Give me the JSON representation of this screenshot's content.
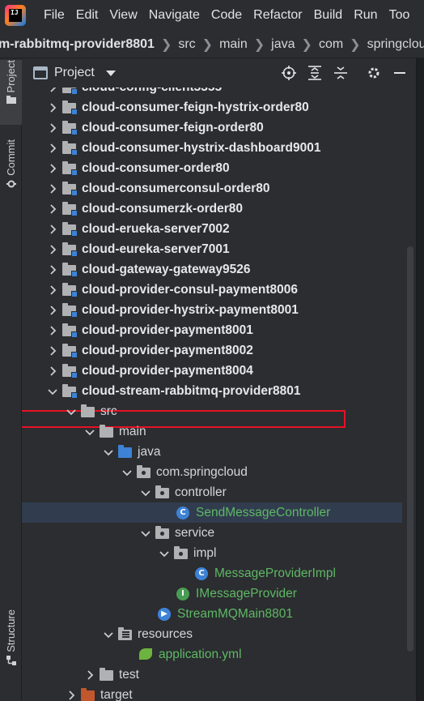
{
  "menu": [
    "File",
    "Edit",
    "View",
    "Navigate",
    "Code",
    "Refactor",
    "Build",
    "Run",
    "Too"
  ],
  "breadcrumb": [
    "m-rabbitmq-provider8801",
    "src",
    "main",
    "java",
    "com",
    "springcloud"
  ],
  "toolstrip": {
    "project_label": "Project",
    "commit_label": "Commit",
    "structure_label": "Structure"
  },
  "panel": {
    "title": "Project"
  },
  "tree": [
    {
      "label": "cloud-config-client3355",
      "type": "module",
      "depth": 0,
      "chevron": "right"
    },
    {
      "label": "cloud-consumer-feign-hystrix-order80",
      "type": "module",
      "depth": 0,
      "chevron": "right"
    },
    {
      "label": "cloud-consumer-feign-order80",
      "type": "module",
      "depth": 0,
      "chevron": "right"
    },
    {
      "label": "cloud-consumer-hystrix-dashboard9001",
      "type": "module",
      "depth": 0,
      "chevron": "right"
    },
    {
      "label": "cloud-consumer-order80",
      "type": "module",
      "depth": 0,
      "chevron": "right"
    },
    {
      "label": "cloud-consumerconsul-order80",
      "type": "module",
      "depth": 0,
      "chevron": "right"
    },
    {
      "label": "cloud-consumerzk-order80",
      "type": "module",
      "depth": 0,
      "chevron": "right"
    },
    {
      "label": "cloud-erueka-server7002",
      "type": "module",
      "depth": 0,
      "chevron": "right"
    },
    {
      "label": "cloud-eureka-server7001",
      "type": "module",
      "depth": 0,
      "chevron": "right"
    },
    {
      "label": "cloud-gateway-gateway9526",
      "type": "module",
      "depth": 0,
      "chevron": "right"
    },
    {
      "label": "cloud-provider-consul-payment8006",
      "type": "module",
      "depth": 0,
      "chevron": "right"
    },
    {
      "label": "cloud-provider-hystrix-payment8001",
      "type": "module",
      "depth": 0,
      "chevron": "right"
    },
    {
      "label": "cloud-provider-payment8001",
      "type": "module",
      "depth": 0,
      "chevron": "right"
    },
    {
      "label": "cloud-provider-payment8002",
      "type": "module",
      "depth": 0,
      "chevron": "right"
    },
    {
      "label": "cloud-provider-payment8004",
      "type": "module",
      "depth": 0,
      "chevron": "right"
    },
    {
      "label": "cloud-stream-rabbitmq-provider8801",
      "type": "module",
      "depth": 0,
      "chevron": "down"
    },
    {
      "label": "src",
      "type": "folder",
      "depth": 1,
      "chevron": "down"
    },
    {
      "label": "main",
      "type": "folder",
      "depth": 2,
      "chevron": "down"
    },
    {
      "label": "java",
      "type": "source-folder",
      "depth": 3,
      "chevron": "down"
    },
    {
      "label": "com.springcloud",
      "type": "package",
      "depth": 4,
      "chevron": "down"
    },
    {
      "label": "controller",
      "type": "package",
      "depth": 5,
      "chevron": "down"
    },
    {
      "label": "SendMessageController",
      "type": "class",
      "depth": 7,
      "chevron": "none",
      "selected": true
    },
    {
      "label": "service",
      "type": "package",
      "depth": 5,
      "chevron": "down"
    },
    {
      "label": "impl",
      "type": "package",
      "depth": 6,
      "chevron": "down"
    },
    {
      "label": "MessageProviderImpl",
      "type": "class",
      "depth": 8,
      "chevron": "none"
    },
    {
      "label": "IMessageProvider",
      "type": "interface",
      "depth": 7,
      "chevron": "none"
    },
    {
      "label": "StreamMQMain8801",
      "type": "main-class",
      "depth": 6,
      "chevron": "none"
    },
    {
      "label": "resources",
      "type": "resources",
      "depth": 3,
      "chevron": "down"
    },
    {
      "label": "application.yml",
      "type": "yaml",
      "depth": 5,
      "chevron": "none"
    },
    {
      "label": "test",
      "type": "folder",
      "depth": 2,
      "chevron": "right"
    },
    {
      "label": "target",
      "type": "excluded-folder",
      "depth": 1,
      "chevron": "right"
    }
  ],
  "colors": {
    "accent": "#3d82d6",
    "highlight_border": "#e81123",
    "class_text": "#5fb865"
  }
}
